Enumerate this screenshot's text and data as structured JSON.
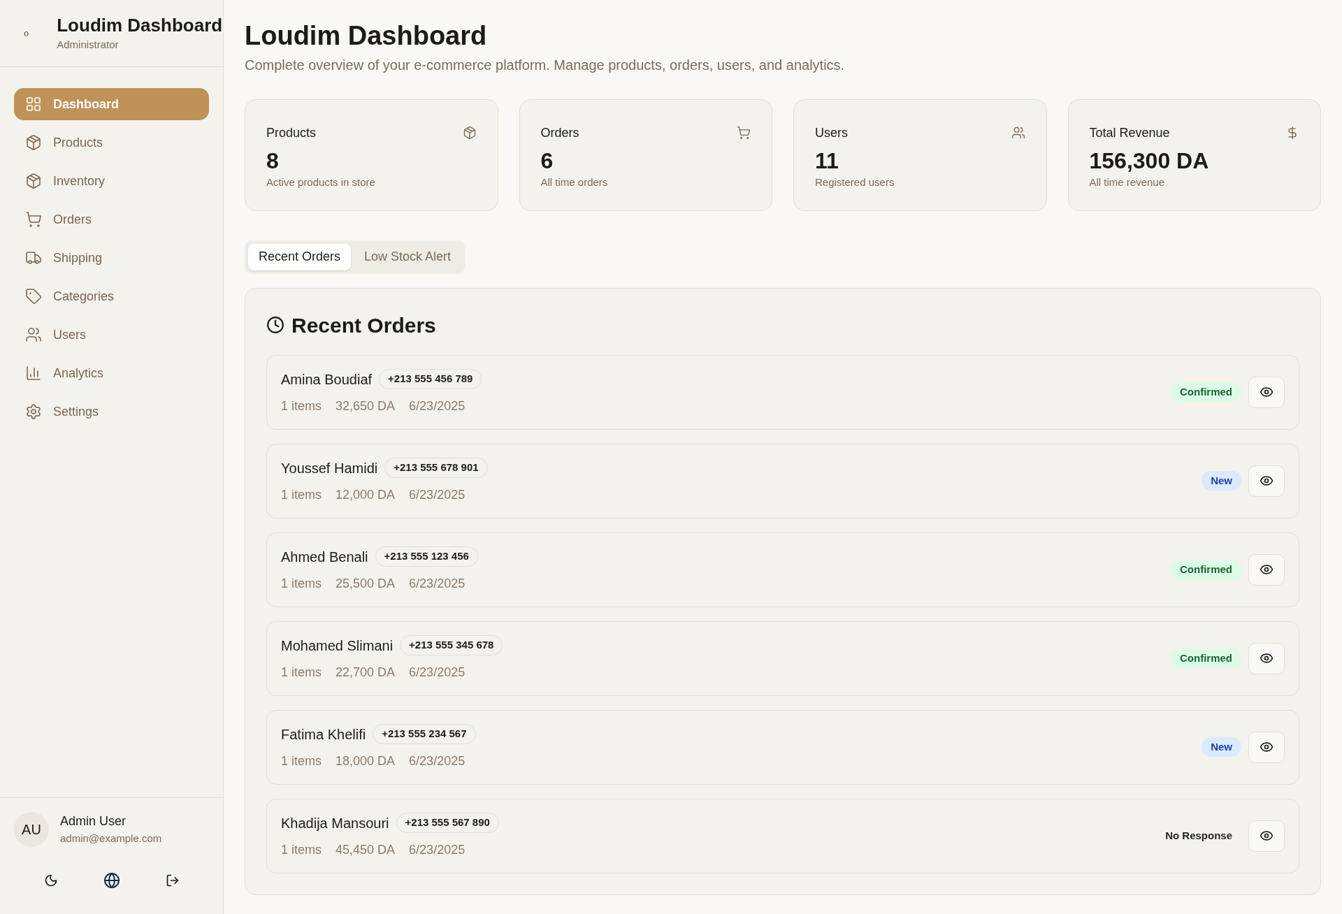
{
  "sidebar": {
    "logo_text": "o",
    "title": "Loudim Dashboard",
    "subtitle": "Administrator",
    "items": [
      {
        "label": "Dashboard",
        "selected": true
      },
      {
        "label": "Products",
        "selected": false
      },
      {
        "label": "Inventory",
        "selected": false
      },
      {
        "label": "Orders",
        "selected": false
      },
      {
        "label": "Shipping",
        "selected": false
      },
      {
        "label": "Categories",
        "selected": false
      },
      {
        "label": "Users",
        "selected": false
      },
      {
        "label": "Analytics",
        "selected": false
      },
      {
        "label": "Settings",
        "selected": false
      }
    ],
    "user": {
      "initials": "AU",
      "name": "Admin User",
      "email": "admin@example.com"
    }
  },
  "header": {
    "title": "Loudim Dashboard",
    "subtitle": "Complete overview of your e-commerce platform. Manage products, orders, users, and analytics."
  },
  "stats": [
    {
      "label": "Products",
      "value": "8",
      "note": "Active products in store"
    },
    {
      "label": "Orders",
      "value": "6",
      "note": "All time orders"
    },
    {
      "label": "Users",
      "value": "11",
      "note": "Registered users"
    },
    {
      "label": "Total Revenue",
      "value": "156,300 DA",
      "note": "All time revenue"
    }
  ],
  "tabs": [
    {
      "label": "Recent Orders",
      "selected": true
    },
    {
      "label": "Low Stock Alert",
      "selected": false
    }
  ],
  "recent_orders": {
    "title": "Recent Orders",
    "orders": [
      {
        "name": "Amina Boudiaf",
        "phone": "+213 555 456 789",
        "items": "1 items",
        "total": "32,650 DA",
        "date": "6/23/2025",
        "status": "Confirmed",
        "kind": "confirmed"
      },
      {
        "name": "Youssef Hamidi",
        "phone": "+213 555 678 901",
        "items": "1 items",
        "total": "12,000 DA",
        "date": "6/23/2025",
        "status": "New",
        "kind": "new"
      },
      {
        "name": "Ahmed Benali",
        "phone": "+213 555 123 456",
        "items": "1 items",
        "total": "25,500 DA",
        "date": "6/23/2025",
        "status": "Confirmed",
        "kind": "confirmed"
      },
      {
        "name": "Mohamed Slimani",
        "phone": "+213 555 345 678",
        "items": "1 items",
        "total": "22,700 DA",
        "date": "6/23/2025",
        "status": "Confirmed",
        "kind": "confirmed"
      },
      {
        "name": "Fatima Khelifi",
        "phone": "+213 555 234 567",
        "items": "1 items",
        "total": "18,000 DA",
        "date": "6/23/2025",
        "status": "New",
        "kind": "new"
      },
      {
        "name": "Khadija Mansouri",
        "phone": "+213 555 567 890",
        "items": "1 items",
        "total": "45,450 DA",
        "date": "6/23/2025",
        "status": "No Response",
        "kind": "no_response"
      }
    ]
  }
}
